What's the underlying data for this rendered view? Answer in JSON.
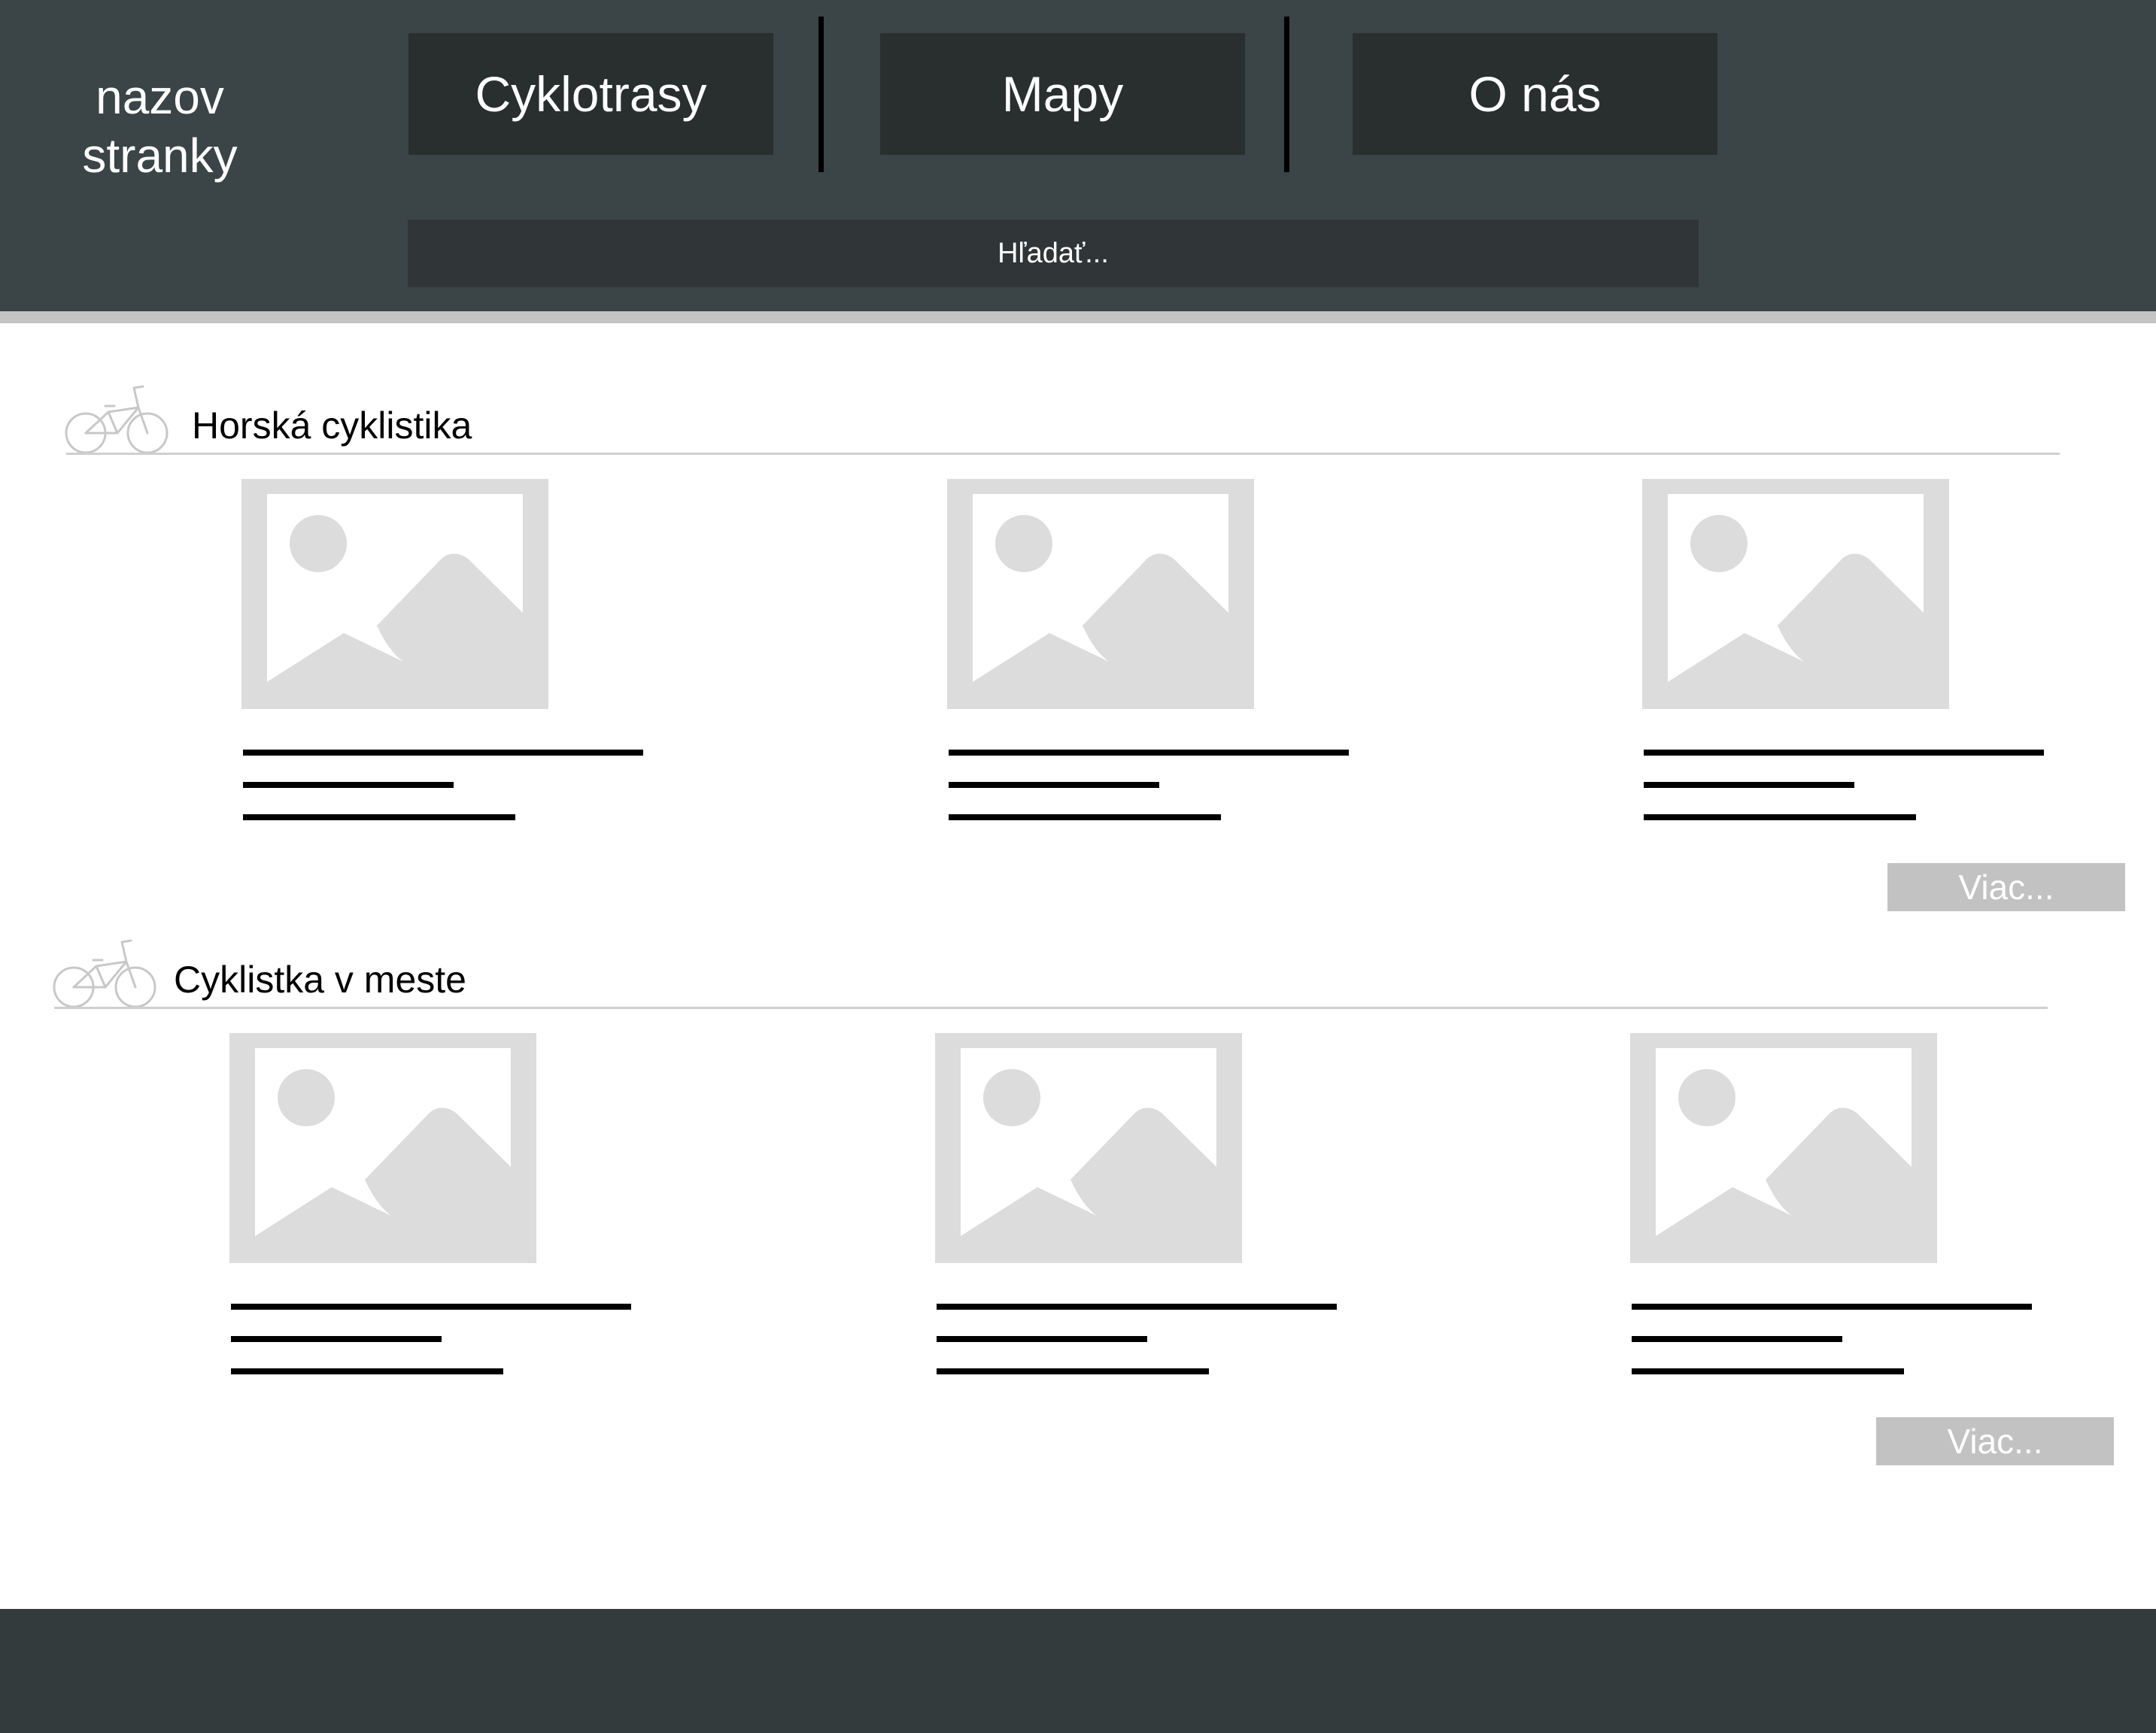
{
  "header": {
    "site_title_line1": "nazov",
    "site_title_line2": "stranky",
    "nav": [
      {
        "label": "Cyklotrasy"
      },
      {
        "label": "Mapy"
      },
      {
        "label": "O nás"
      }
    ],
    "search_placeholder": "Hľadať..."
  },
  "sections": [
    {
      "title": "Horská cyklistika",
      "more_label": "Viac...",
      "icon": "bicycle-icon"
    },
    {
      "title": "Cyklistka v meste",
      "more_label": "Viac...",
      "icon": "bicycle-icon"
    }
  ],
  "card_icon": "image-placeholder-icon",
  "colors": {
    "header_bg": "#3b4446",
    "nav_button_bg": "#292e2f",
    "search_bg": "#303637",
    "placeholder_gray": "#dcdcdc",
    "more_button_bg": "#c2c2c2",
    "footer_bg": "#343b3d"
  }
}
